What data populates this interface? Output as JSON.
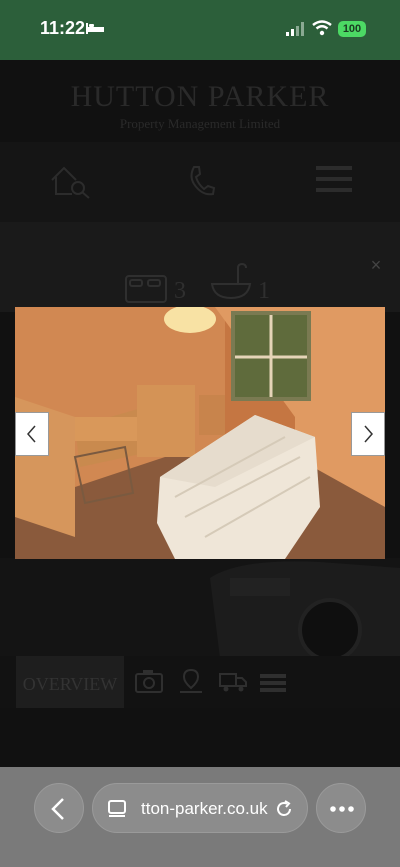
{
  "status_bar": {
    "time": "11:22",
    "battery": "100",
    "icons": [
      "bed-icon",
      "cellular-signal-icon",
      "wifi-icon",
      "battery-icon"
    ]
  },
  "site": {
    "brand_name": "HUTTON PARKER",
    "brand_subtitle": "Property Management Limited",
    "nav_icons": [
      "house-search-icon",
      "phone-icon",
      "hamburger-menu-icon"
    ],
    "features": {
      "bedrooms": "3",
      "bathrooms": "1"
    },
    "tabs": {
      "overview_label": "OVERVIEW",
      "icons": [
        "camera-icon",
        "map-pin-icon",
        "truck-icon",
        "stack-icon"
      ]
    }
  },
  "lightbox": {
    "close_icon": "close-icon",
    "prev_icon": "chevron-left-icon",
    "next_icon": "chevron-right-icon"
  },
  "browser": {
    "url": "tton-parker.co.uk",
    "icons": [
      "back-icon",
      "page-icon",
      "reload-icon",
      "more-icon"
    ]
  },
  "colors": {
    "status_bar": "#2c5f3a",
    "battery": "#4cd964",
    "browser_bar": "#7a7a7a"
  }
}
